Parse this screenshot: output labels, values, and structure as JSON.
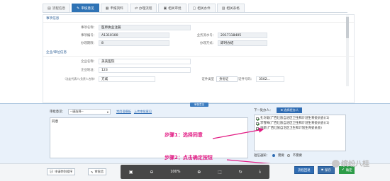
{
  "tabs": [
    {
      "label": "流程信息",
      "icon": "info-icon",
      "active": false
    },
    {
      "label": "审核意见",
      "icon": "edit-icon",
      "active": true
    },
    {
      "label": "申报资料",
      "icon": "doc-icon",
      "active": false
    },
    {
      "label": "办理流程",
      "icon": "flow-icon",
      "active": false
    },
    {
      "label": "相关审批",
      "icon": "approve-icon",
      "active": false
    },
    {
      "label": "相关办件",
      "icon": "file-icon",
      "active": false
    },
    {
      "label": "相关表格",
      "icon": "table-icon",
      "active": false
    }
  ],
  "matter_section": {
    "title": "事项信息",
    "name_label": "事项名称：",
    "name_value": "医师执业注册",
    "code_label": "事项编号：",
    "code_value": "A1310100",
    "days_label": "办理期限：",
    "days_value": "8",
    "type_label": "办理方式：",
    "type_value": "即时办结",
    "no_label": "业务流水号：",
    "no_value": "2017118405"
  },
  "enterprise_section": {
    "title": "企业/单位信息",
    "name_label": "企业名称：",
    "name_value": "美美医院",
    "code_label": "企业地址：",
    "code_value": "123",
    "legal_label": "（法定代表人/负责人名称）",
    "legal_value": "方威",
    "cert_label": "证件类型",
    "cert_value": "身份证",
    "certno_label": "证件号码：",
    "certno_value": "3502..."
  },
  "approval": {
    "collapse_label": "审核意见",
    "op_label": "审批意见：",
    "op_select": "--请选择--",
    "link_common": "常用语模板",
    "link_upload": "上传审批意见",
    "opinion_text": "同意"
  },
  "next": {
    "label": "下一处办人：",
    "add_button": "选择经办人",
    "items": [
      {
        "text": "孔令毅(广西壮族自治区卫生和计划生育委员会)(1)",
        "checked": true
      },
      {
        "text": "李雪梅(广西壮族自治区卫生和计划生育委员会)(1)",
        "checked": true
      },
      {
        "text": "张新(广西壮族自治区卫生和计划生育委员会)",
        "checked": true
      }
    ],
    "sms_label": "短信通知：",
    "sms_yes": "需要",
    "sms_no": "不需要"
  },
  "callouts": {
    "step1": "步骤1：选择同意",
    "step2": "步骤2：点击确定按钮"
  },
  "footer": {
    "left_btn1": "申请特别程序",
    "left_btn2": "审批信",
    "zoom": "100%",
    "flow_btn": "流程回退",
    "save_btn": "保存",
    "ok_btn": "确定"
  },
  "watermark": "缤纷八桂",
  "colors": {
    "accent": "#2f6cb3",
    "ok": "#2c9c48",
    "callout": "#e21c84"
  }
}
